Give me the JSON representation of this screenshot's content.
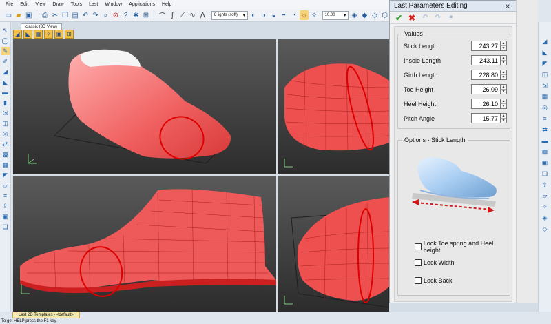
{
  "menu": [
    "File",
    "Edit",
    "View",
    "Draw",
    "Tools",
    "Last",
    "Window",
    "Applications",
    "Help"
  ],
  "toolbar": {
    "lights": "6 lights (soft)",
    "zoom_value": "10.00"
  },
  "document_tab": "classic (3D View)",
  "bottom_tab": "Last 2D Templates - <default>",
  "status": "To get HELP press the F1 key.",
  "panel": {
    "title": "Last Parameters Editing",
    "close_label": "×",
    "values_group": "Values",
    "fields": [
      {
        "label": "Stick Length",
        "value": "243.27"
      },
      {
        "label": "Insole Length",
        "value": "243.11"
      },
      {
        "label": "Girth Length",
        "value": "228.80"
      },
      {
        "label": "Toe Height",
        "value": "26.09"
      },
      {
        "label": "Heel Height",
        "value": "26.10"
      },
      {
        "label": "Pitch Angle",
        "value": "15.77"
      }
    ],
    "options_group": "Options - Stick Length",
    "checks": [
      {
        "label": "Lock Toe spring and Heel height",
        "checked": false
      },
      {
        "label": "Lock Width",
        "checked": false
      },
      {
        "label": "Lock Back",
        "checked": false
      }
    ]
  },
  "colors": {
    "last_red": "#f05a5a",
    "viewport_bg": "#3a3a3a",
    "accent_green": "#2e9d2e",
    "accent_red": "#d02020"
  }
}
